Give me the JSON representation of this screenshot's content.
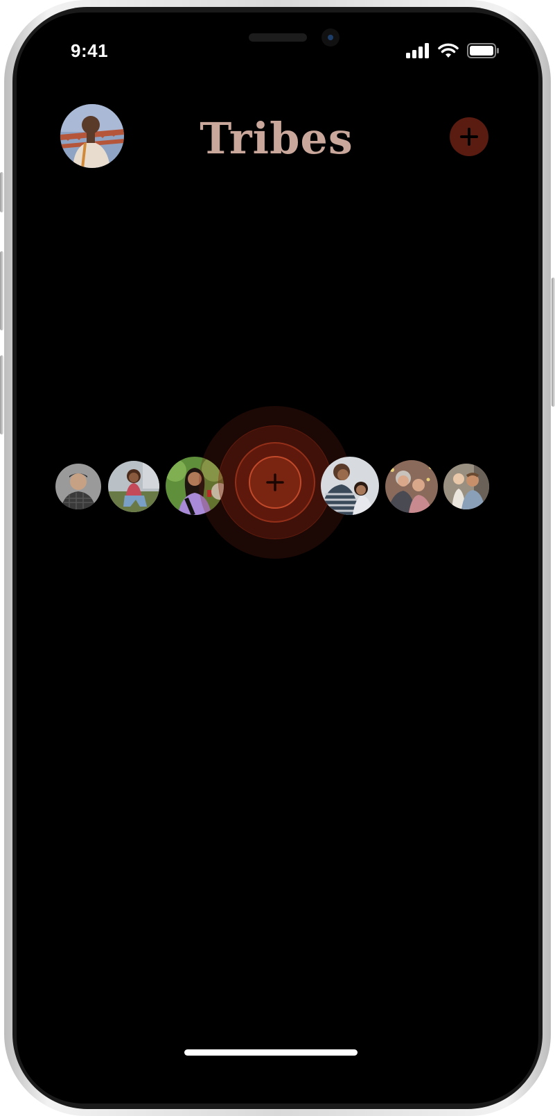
{
  "status_bar": {
    "time": "9:41"
  },
  "header": {
    "title": "Tribes"
  },
  "colors": {
    "title": "#c9a79b",
    "accent_dark": "#5a1b10",
    "hub": "#7a2512",
    "hub_border": "#c24a2a",
    "background": "#000000"
  },
  "icons": {
    "profile": "avatar",
    "add": "plus-icon",
    "hub_add": "plus-icon",
    "signal": "cellular-signal-icon",
    "wifi": "wifi-icon",
    "battery": "battery-icon"
  },
  "friends_left": [
    "friend-1",
    "friend-2",
    "friend-3"
  ],
  "friends_right": [
    "friend-4",
    "friend-5",
    "friend-6"
  ]
}
